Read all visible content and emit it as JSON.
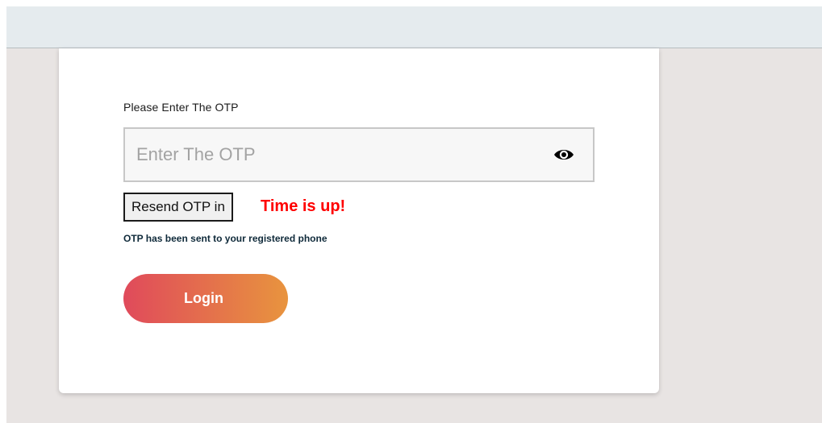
{
  "otp_form": {
    "label": "Please Enter The OTP",
    "input_value": "",
    "input_placeholder": "Enter The OTP",
    "toggle_icon": "eye-icon",
    "resend_label": "Resend OTP in",
    "timer_status": "Time is up!",
    "sent_note": "OTP has been sent to your registered phone",
    "login_label": "Login"
  },
  "colors": {
    "page_background": "#e8e4e3",
    "top_bar": "#e5ebee",
    "card": "#ffffff",
    "timer_status": "#ff0000",
    "note_text": "#0f2a3a",
    "login_gradient_start": "#e04a5b",
    "login_gradient_end": "#e8943e"
  }
}
